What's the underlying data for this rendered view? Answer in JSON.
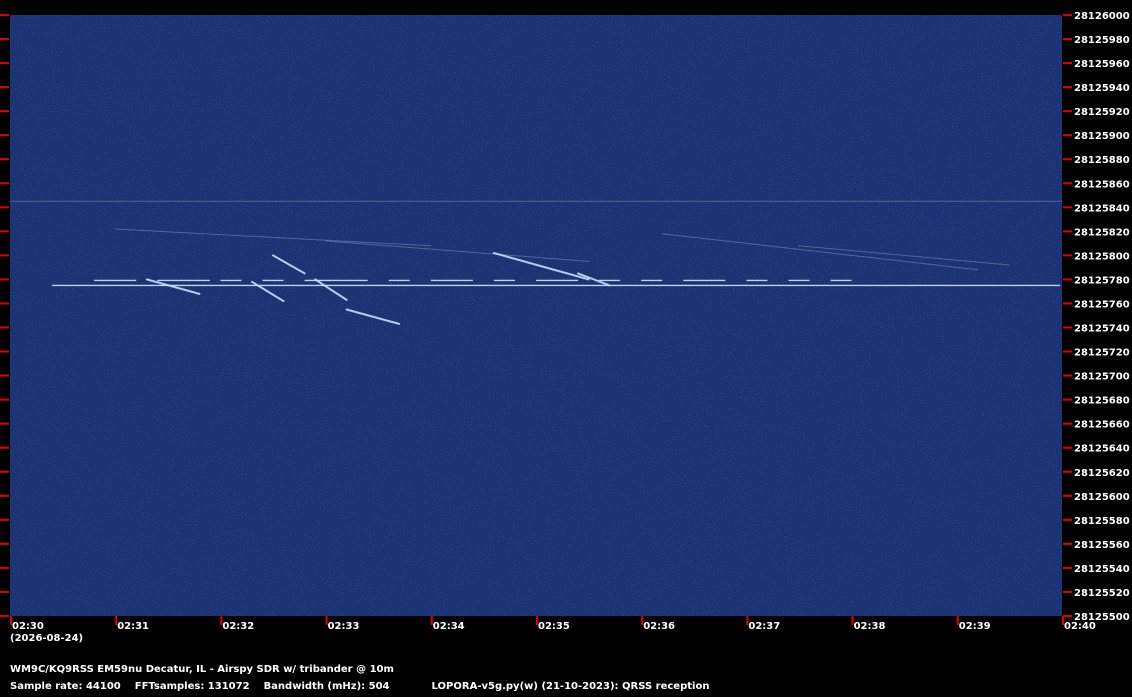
{
  "chart_data": {
    "type": "heatmap",
    "title": "",
    "x": [
      "02:30",
      "02:31",
      "02:32",
      "02:33",
      "02:34",
      "02:35",
      "02:36",
      "02:37",
      "02:38",
      "02:39",
      "02:40"
    ],
    "xlabel": "",
    "ylabel": "",
    "xlim": [
      "02:30",
      "02:40"
    ],
    "ylim": [
      28125500,
      28126000
    ],
    "y_ticks": [
      28126000,
      28125980,
      28125960,
      28125940,
      28125920,
      28125900,
      28125880,
      28125860,
      28125840,
      28125820,
      28125800,
      28125780,
      28125760,
      28125740,
      28125720,
      28125700,
      28125680,
      28125660,
      28125640,
      28125620,
      28125600,
      28125580,
      28125560,
      28125540,
      28125520,
      28125500
    ],
    "date": "(2026-08-24)",
    "carrier_hz": 28125775,
    "traces": [
      {
        "kind": "faint-line",
        "points": [
          [
            "02:30",
            28125845
          ],
          [
            "02:40",
            28125845
          ]
        ]
      },
      {
        "kind": "faint-line",
        "points": [
          [
            "02:31",
            28125822
          ],
          [
            "02:34",
            28125808
          ]
        ]
      },
      {
        "kind": "faint-line",
        "points": [
          [
            "02:33",
            28125812
          ],
          [
            "02:35.5",
            28125795
          ]
        ]
      },
      {
        "kind": "faint-line",
        "points": [
          [
            "02:36.2",
            28125818
          ],
          [
            "02:39.2",
            28125788
          ]
        ]
      },
      {
        "kind": "faint-line",
        "points": [
          [
            "02:37.5",
            28125808
          ],
          [
            "02:39.5",
            28125792
          ]
        ]
      },
      {
        "kind": "doppler",
        "points": [
          [
            "02:31.3",
            28125780
          ],
          [
            "02:31.8",
            28125768
          ]
        ]
      },
      {
        "kind": "doppler",
        "points": [
          [
            "02:32.3",
            28125778
          ],
          [
            "02:32.6",
            28125762
          ]
        ]
      },
      {
        "kind": "doppler",
        "points": [
          [
            "02:32.5",
            28125800
          ],
          [
            "02:32.8",
            28125785
          ]
        ]
      },
      {
        "kind": "doppler",
        "points": [
          [
            "02:32.9",
            28125780
          ],
          [
            "02:33.2",
            28125763
          ]
        ]
      },
      {
        "kind": "doppler",
        "points": [
          [
            "02:33.2",
            28125755
          ],
          [
            "02:33.7",
            28125743
          ]
        ]
      },
      {
        "kind": "doppler",
        "points": [
          [
            "02:34.6",
            28125802
          ],
          [
            "02:35.5",
            28125780
          ]
        ]
      },
      {
        "kind": "doppler",
        "points": [
          [
            "02:35.4",
            28125785
          ],
          [
            "02:35.7",
            28125775
          ]
        ]
      }
    ],
    "grid": false,
    "legend": "none",
    "colors": {
      "background": "#0b1f5e",
      "trace": "#cfe6ff",
      "axis": "#000000",
      "tick": "#e00000"
    }
  },
  "footer": {
    "station": "WM9C/KQ9RSS EM59nu Decatur, IL - Airspy SDR w/ tribander @ 10m",
    "sample_rate": "Sample rate: 44100",
    "fft_samples": "FFTsamples: 131072",
    "bandwidth": "Bandwidth (mHz): 504",
    "software": "LOPORA-v5g.py(w) (21-10-2023): QRSS reception"
  }
}
